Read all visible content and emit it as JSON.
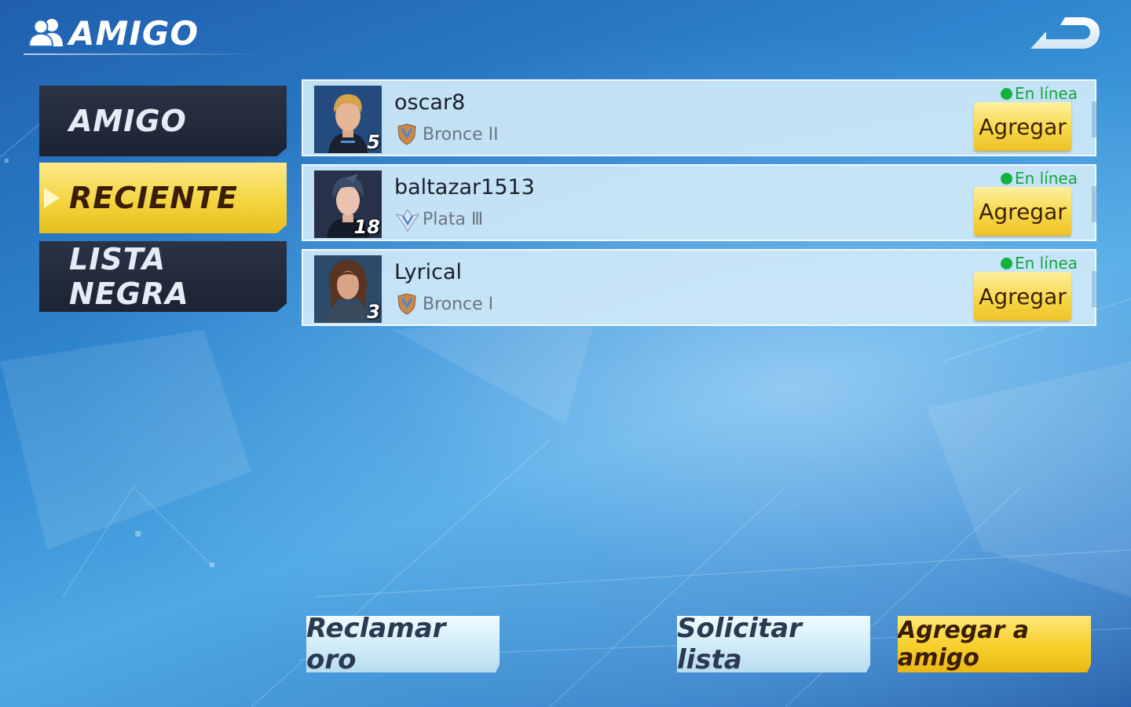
{
  "header": {
    "title": "AMIGO",
    "icon": "friends-icon"
  },
  "tabs": [
    {
      "label": "AMIGO",
      "active": false
    },
    {
      "label": "RECIENTE",
      "active": true
    },
    {
      "label": "LISTA NEGRA",
      "active": false
    }
  ],
  "friends": [
    {
      "name": "oscar8",
      "level": "5",
      "rank": "Bronce  II",
      "rank_tier": "bronze",
      "status": "En línea",
      "add_label": "Agregar"
    },
    {
      "name": "baltazar1513",
      "level": "18",
      "rank": "Plata  Ⅲ",
      "rank_tier": "silver",
      "status": "En línea",
      "add_label": "Agregar"
    },
    {
      "name": "Lyrical",
      "level": "3",
      "rank": "Bronce I",
      "rank_tier": "bronze",
      "status": "En línea",
      "add_label": "Agregar"
    }
  ],
  "bottom": {
    "claim_gold": "Reclamar oro",
    "request_list": "Solicitar lista",
    "add_friend": "Agregar a amigo"
  },
  "colors": {
    "accent_gold": "#f6cf2a",
    "online_green": "#12b33d",
    "tab_dark": "#1c2333"
  }
}
